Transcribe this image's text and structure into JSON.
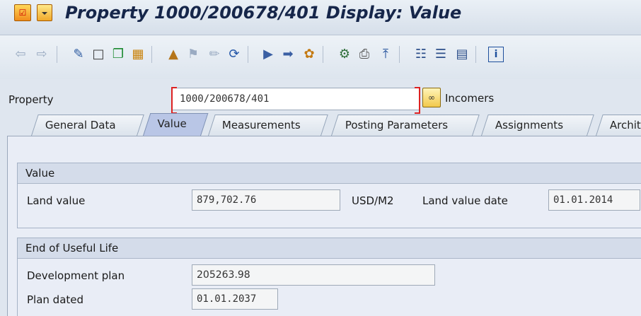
{
  "window": {
    "title": "Property 1000/200678/401 Display: Value"
  },
  "toolbar": {
    "icons": [
      "back-arrow-icon",
      "forward-arrow-icon",
      "display-change-icon",
      "new-document-icon",
      "copy-icon",
      "other-property-icon",
      "hierarchy-icon",
      "flag-icon",
      "edit-icon",
      "refresh-icon",
      "export-icon",
      "next-icon",
      "settings-icon",
      "find-icon",
      "print-icon",
      "transport-icon",
      "structure-icon",
      "list-icon",
      "table-icon",
      "info-icon"
    ]
  },
  "property": {
    "label": "Property",
    "value": "1000/200678/401",
    "description": "Incomers"
  },
  "tabs": [
    {
      "label": "General Data",
      "active": false
    },
    {
      "label": "Value",
      "active": true
    },
    {
      "label": "Measurements",
      "active": false
    },
    {
      "label": "Posting Parameters",
      "active": false
    },
    {
      "label": "Assignments",
      "active": false
    },
    {
      "label": "Archit",
      "active": false
    }
  ],
  "value_group": {
    "title": "Value",
    "land_value_label": "Land value",
    "land_value": "879,702.76",
    "unit": "USD/M2",
    "land_value_date_label": "Land value date",
    "land_value_date": "01.01.2014"
  },
  "useful_life_group": {
    "title": "End of Useful Life",
    "development_plan_label": "Development plan",
    "development_plan": "205263.98",
    "plan_dated_label": "Plan dated",
    "plan_dated": "01.01.2037"
  }
}
